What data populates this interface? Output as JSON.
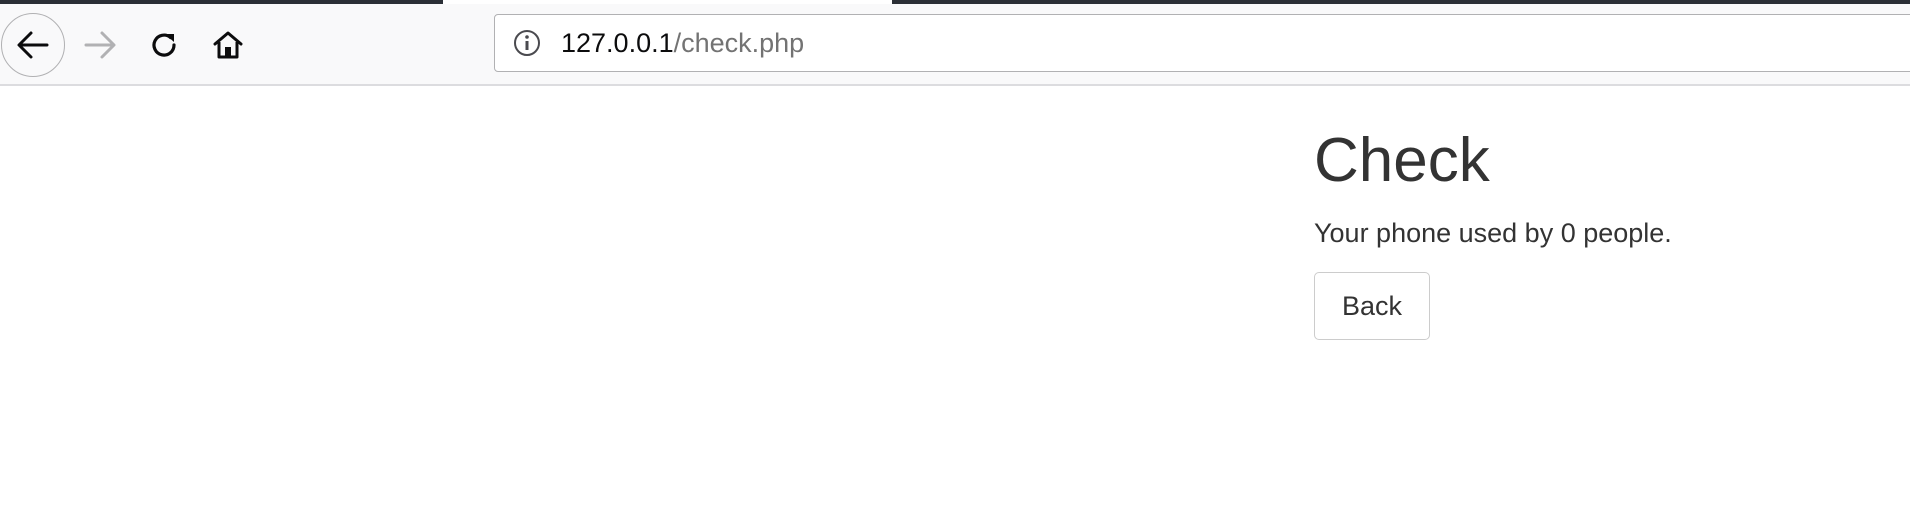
{
  "browser": {
    "url_host": "127.0.0.1",
    "url_path": "/check.php",
    "icons": {
      "back": "back-arrow-icon",
      "forward": "forward-arrow-icon",
      "reload": "reload-icon",
      "home": "home-icon",
      "site_info": "info-icon"
    },
    "colors": {
      "toolbar_bg": "#f9f9fa",
      "forward_disabled": "#b1b1b3",
      "icon": "#0c0c0d"
    }
  },
  "page": {
    "title": "Check",
    "message": "Your phone used by 0 people.",
    "back_label": "Back",
    "colors": {
      "text": "#333333",
      "button_border": "#cccccc"
    }
  }
}
